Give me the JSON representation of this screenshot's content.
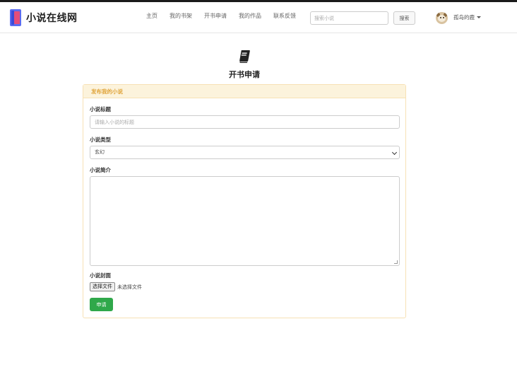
{
  "brand": {
    "name": "小说在线网"
  },
  "nav": {
    "items": [
      {
        "label": "主页"
      },
      {
        "label": "我的书架"
      },
      {
        "label": "开书申请"
      },
      {
        "label": "我的作品"
      },
      {
        "label": "联系反馈"
      }
    ]
  },
  "search": {
    "placeholder": "搜索小说",
    "button_label": "搜索"
  },
  "user": {
    "name": "孤岛的鹿"
  },
  "page": {
    "title": "开书申请",
    "icon": "book-icon"
  },
  "form": {
    "panel_title": "发布我的小说",
    "title_label": "小说标题",
    "title_placeholder": "请输入小说的标题",
    "type_label": "小说类型",
    "type_selected": "玄幻",
    "intro_label": "小说简介",
    "cover_label": "小说封面",
    "file_button_label": "选择文件",
    "file_status": "未选择文件",
    "submit_label": "申请"
  },
  "colors": {
    "panel_header_bg": "#fcf3dc",
    "panel_header_text": "#e0a43a",
    "submit_bg": "#2fa84a",
    "brand_blue": "#5b6cf0",
    "brand_pink": "#e44d7a"
  }
}
